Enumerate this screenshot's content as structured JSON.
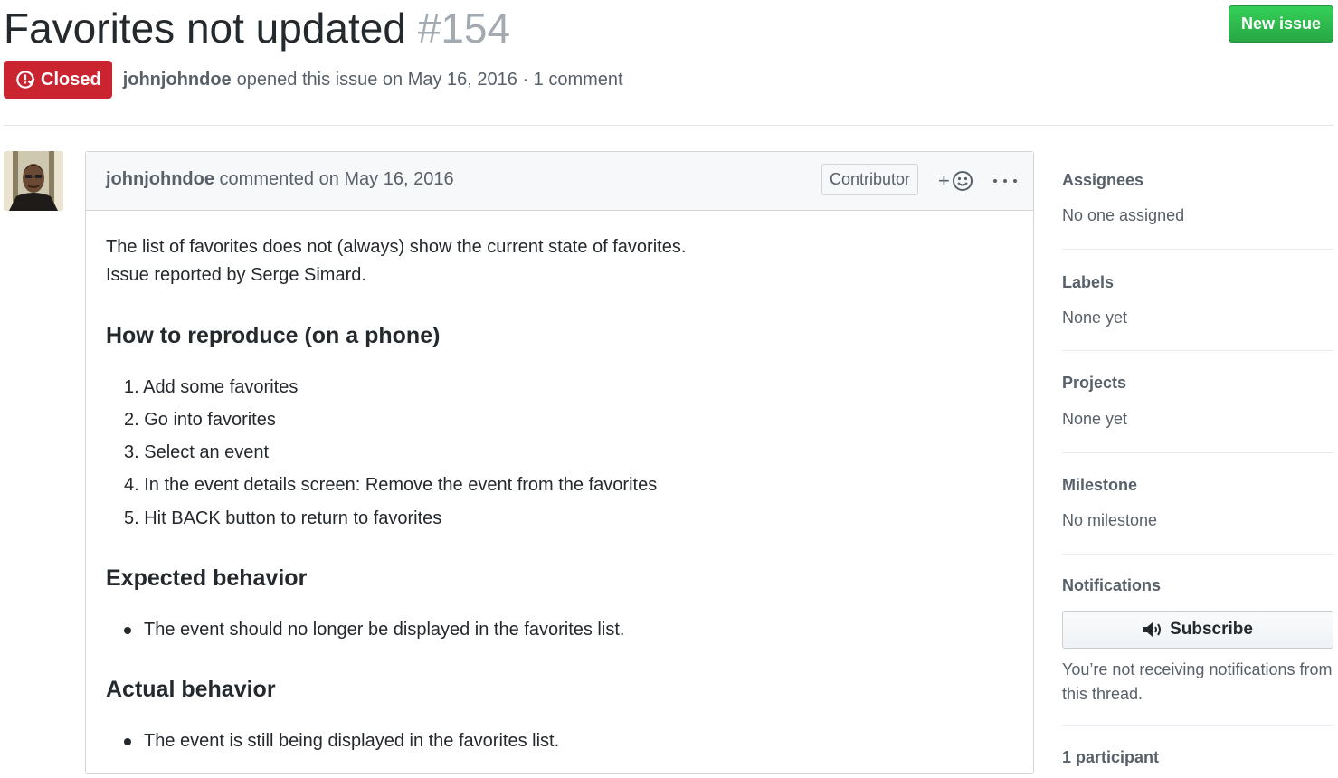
{
  "issue": {
    "title": "Favorites not updated",
    "number": "#154",
    "state": "Closed",
    "author": "johnjohndoe",
    "opened_text": "opened this issue on May 16, 2016 · 1 comment",
    "new_issue_label": "New issue"
  },
  "comment": {
    "author": "johnjohndoe",
    "meta": "commented on May 16, 2016",
    "role": "Contributor",
    "body": {
      "line1": "The list of favorites does not (always) show the current state of favorites.",
      "line2": "Issue reported by Serge Simard.",
      "heading_reproduce": "How to reproduce (on a phone)",
      "steps": [
        "1. Add some favorites",
        "2. Go into favorites",
        "3. Select an event",
        "4. In the event details screen: Remove the event from the favorites",
        "5. Hit BACK button to return to favorites"
      ],
      "heading_expected": "Expected behavior",
      "expected": "The event should no longer be displayed in the favorites list.",
      "heading_actual": "Actual behavior",
      "actual": "The event is still being displayed in the favorites list."
    }
  },
  "sidebar": {
    "assignees": {
      "heading": "Assignees",
      "value": "No one assigned"
    },
    "labels": {
      "heading": "Labels",
      "value": "None yet"
    },
    "projects": {
      "heading": "Projects",
      "value": "None yet"
    },
    "milestone": {
      "heading": "Milestone",
      "value": "No milestone"
    },
    "notifications": {
      "heading": "Notifications",
      "button": "Subscribe",
      "note": "You’re not receiving notifications from this thread."
    },
    "participants": "1 participant"
  },
  "colors": {
    "closed": "#cb2431",
    "new_issue": "#28a745"
  }
}
